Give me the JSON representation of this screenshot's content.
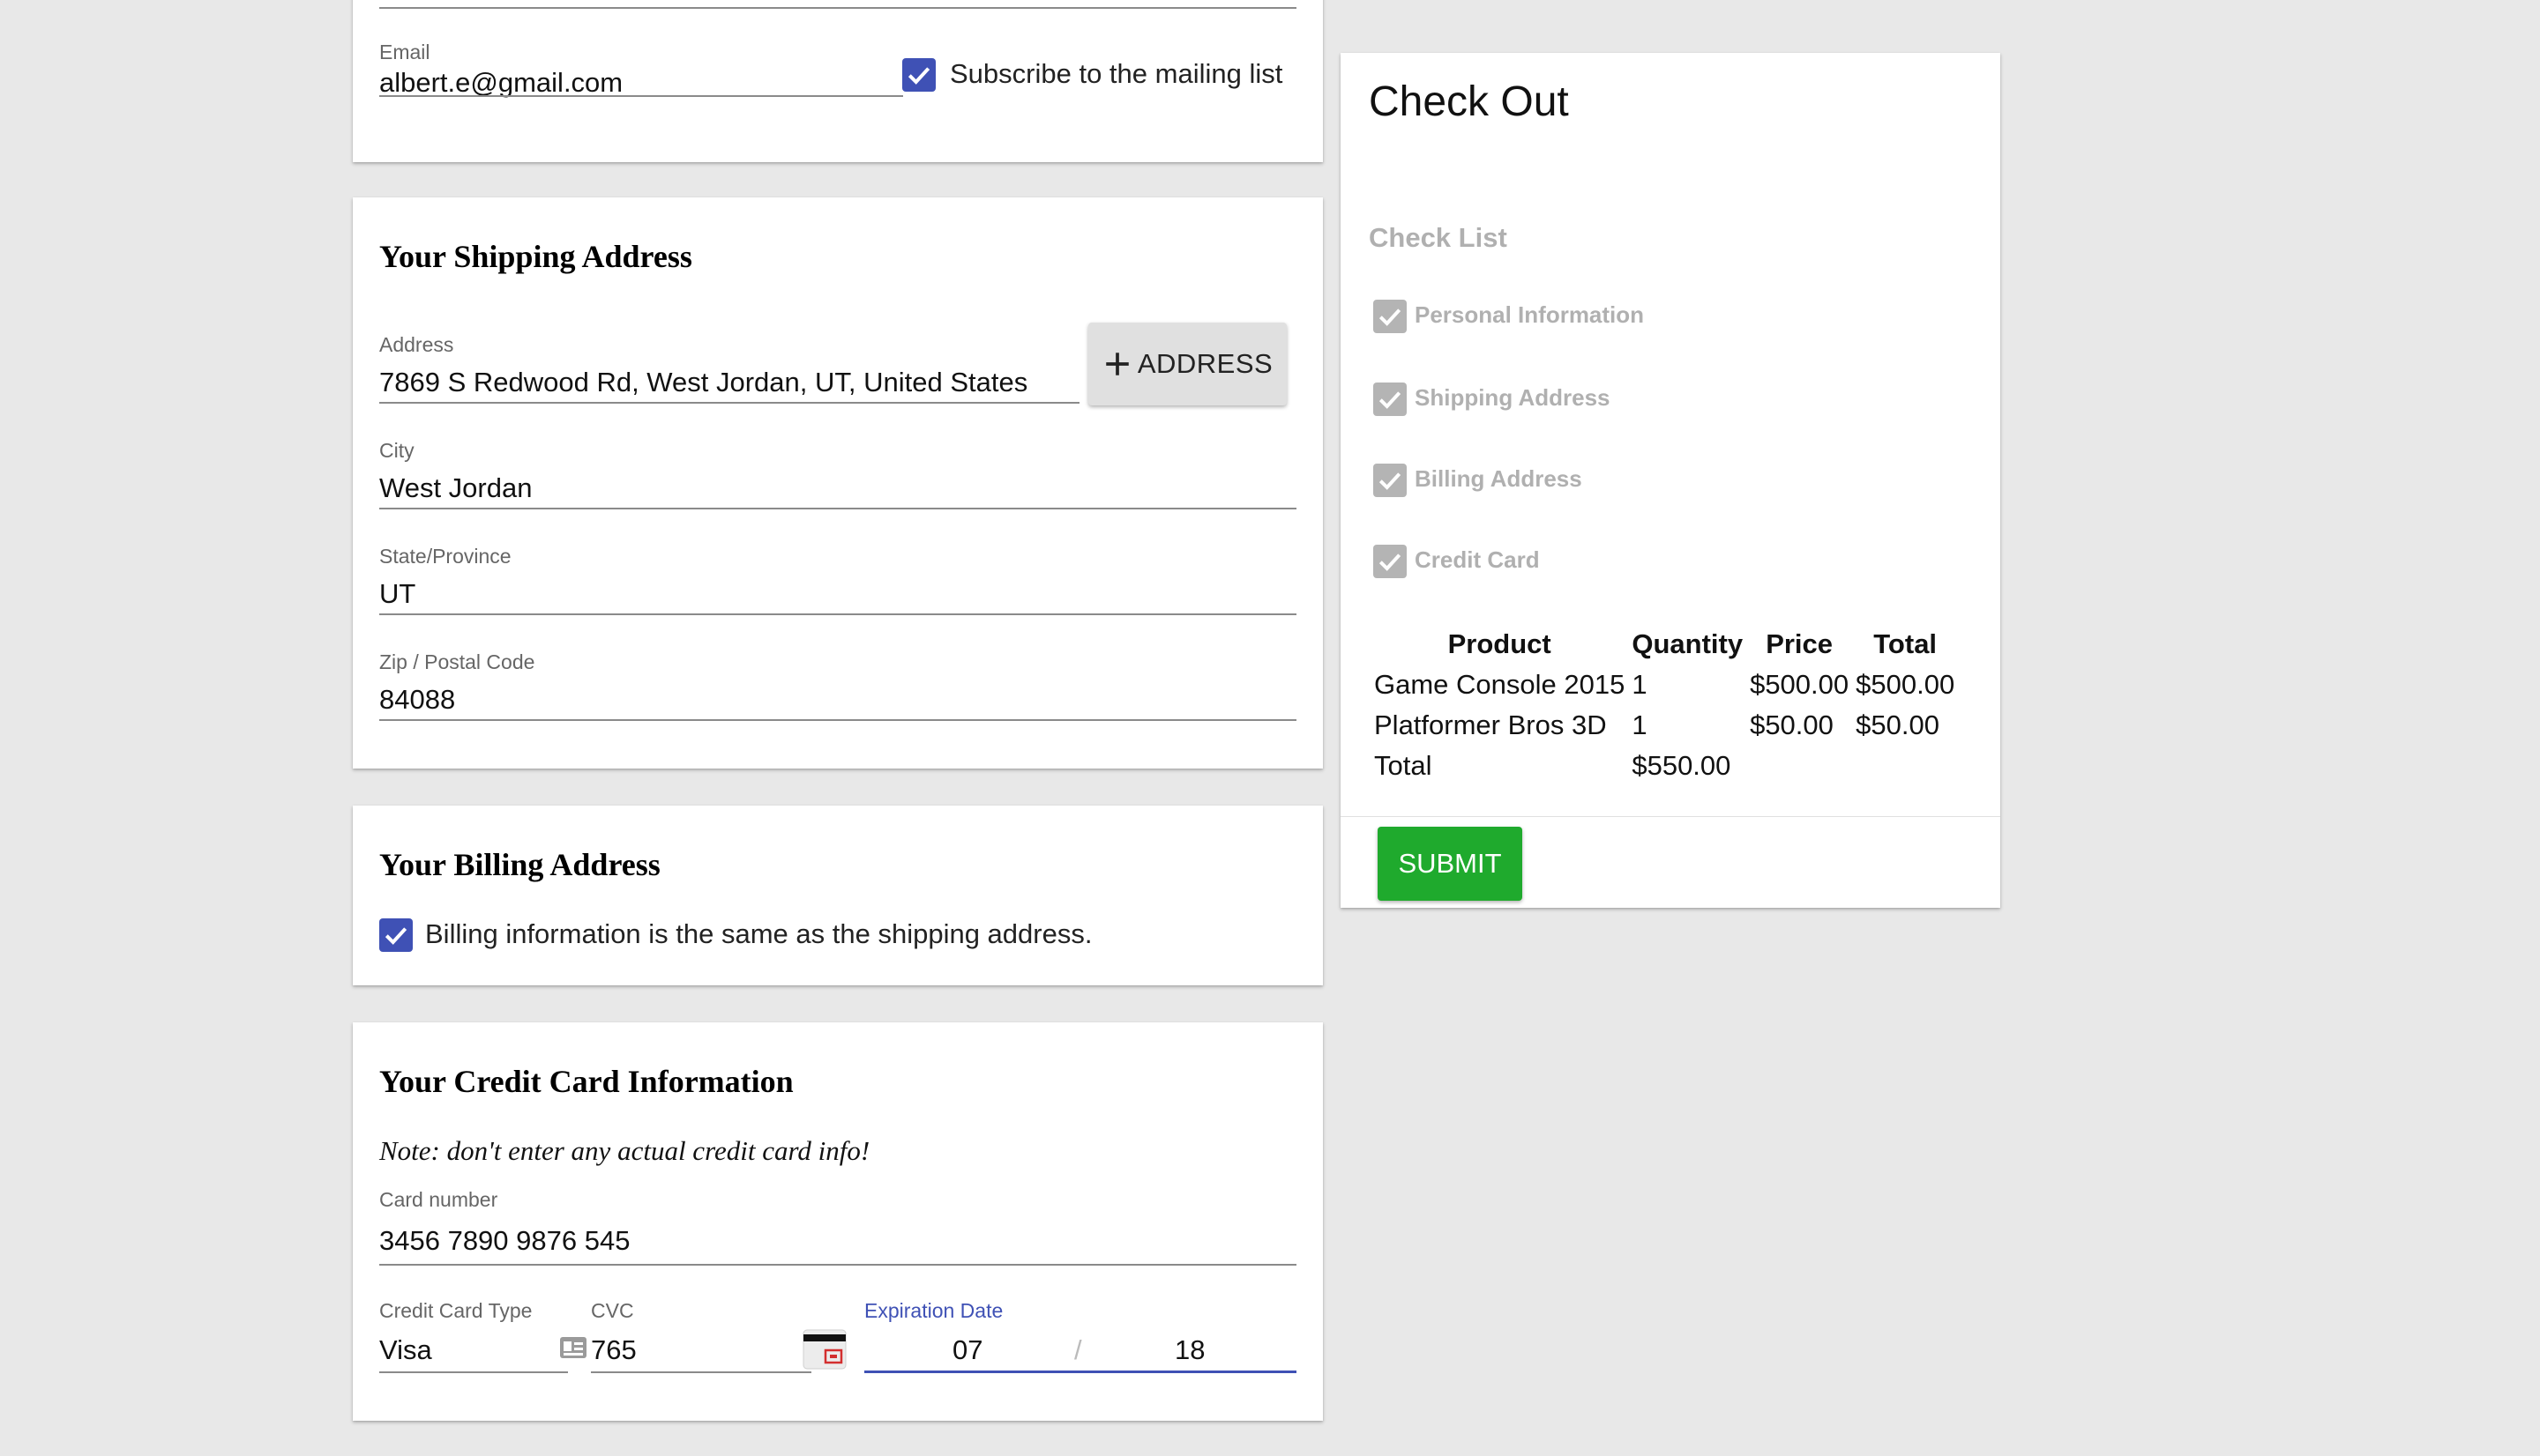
{
  "contact": {
    "email_label": "Email",
    "email_value": "albert.e@gmail.com",
    "subscribe_label": "Subscribe to the mailing list",
    "subscribe_checked": true
  },
  "shipping": {
    "heading": "Your Shipping Address",
    "address_label": "Address",
    "address_value": "7869 S Redwood Rd, West Jordan, UT, United States",
    "add_address_button": "ADDRESS",
    "city_label": "City",
    "city_value": "West Jordan",
    "state_label": "State/Province",
    "state_value": "UT",
    "zip_label": "Zip / Postal Code",
    "zip_value": "84088"
  },
  "billing": {
    "heading": "Your Billing Address",
    "same_as_shipping_label": "Billing information is the same as the shipping address.",
    "same_as_shipping_checked": true
  },
  "credit_card": {
    "heading": "Your Credit Card Information",
    "note": "Note: don't enter any actual credit card info!",
    "card_number_label": "Card number",
    "card_number_value": "3456 7890 9876 545",
    "type_label": "Credit Card Type",
    "type_value": "Visa",
    "cvc_label": "CVC",
    "cvc_value": "765",
    "expiration_label": "Expiration Date",
    "expiration_month": "07",
    "expiration_separator": "/",
    "expiration_year": "18"
  },
  "checkout": {
    "title": "Check Out",
    "checklist_heading": "Check List",
    "checklist_items": [
      {
        "label": "Personal Information",
        "checked": true
      },
      {
        "label": "Shipping Address",
        "checked": true
      },
      {
        "label": "Billing Address",
        "checked": true
      },
      {
        "label": "Credit Card",
        "checked": true
      }
    ],
    "table_headers": [
      "Product",
      "Quantity",
      "Price",
      "Total"
    ],
    "rows": [
      {
        "product": "Game Console 2015",
        "quantity": "1",
        "price": "$500.00",
        "total": "$500.00"
      },
      {
        "product": "Platformer Bros 3D",
        "quantity": "1",
        "price": "$50.00",
        "total": "$50.00"
      }
    ],
    "total_label": "Total",
    "total_value": "$550.00",
    "submit_label": "SUBMIT"
  },
  "colors": {
    "background": "#e8e8e8",
    "checkbox_primary": "#3f51b5",
    "checkbox_disabled": "#b4b4b4",
    "submit": "#1faa2d",
    "focus_underline": "#3f51b5"
  }
}
